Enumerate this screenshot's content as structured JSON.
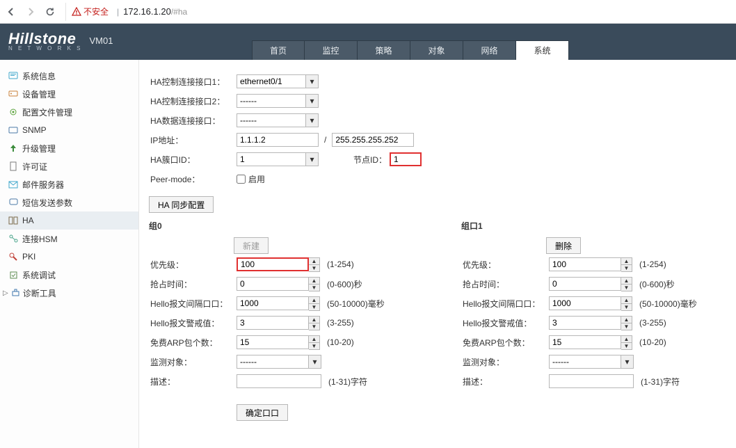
{
  "browser": {
    "warn_label": "不安全",
    "url_host": "172.16.1.20",
    "url_hash": "/#ha"
  },
  "header": {
    "brand": "Hillstone",
    "brand_sub": "N E T W O R K S",
    "hostname": "VM01",
    "tabs": [
      "首页",
      "监控",
      "策略",
      "对象",
      "网络",
      "系统"
    ],
    "active_tab": 5
  },
  "sidebar": {
    "items": [
      {
        "label": "系统信息",
        "icon": "info-icon"
      },
      {
        "label": "设备管理",
        "icon": "device-icon"
      },
      {
        "label": "配置文件管理",
        "icon": "config-icon"
      },
      {
        "label": "SNMP",
        "icon": "snmp-icon"
      },
      {
        "label": "升级管理",
        "icon": "upgrade-icon"
      },
      {
        "label": "许可证",
        "icon": "license-icon"
      },
      {
        "label": "邮件服务器",
        "icon": "mail-icon"
      },
      {
        "label": "短信发送参数",
        "icon": "sms-icon"
      },
      {
        "label": "HA",
        "icon": "ha-icon"
      },
      {
        "label": "连接HSM",
        "icon": "hsm-icon"
      },
      {
        "label": "PKI",
        "icon": "pki-icon"
      },
      {
        "label": "系统调试",
        "icon": "debug-icon"
      }
    ],
    "active": 8,
    "diag_label": "诊断工具"
  },
  "ha": {
    "labels": {
      "ctrl1": "HA控制连接接口1：",
      "ctrl2": "HA控制连接接口2：",
      "data": "HA数据连接接口：",
      "ip": "IP地址：",
      "cluster": "HA簇口ID：",
      "node": "节点ID：",
      "peer": "Peer-mode：",
      "enable": "启用",
      "sync_btn": "HA 同步配置"
    },
    "values": {
      "ctrl1": "ethernet0/1",
      "ctrl2": "------",
      "data": "------",
      "ip": "1.1.1.2",
      "mask": "255.255.255.252",
      "cluster": "1",
      "node": "1"
    }
  },
  "group_labels": {
    "g0": "组0",
    "g1": "组口1",
    "new_btn": "新建",
    "del_btn": "删除",
    "fields": {
      "priority": "优先级：",
      "preempt": "抢占时间：",
      "hello_int": "Hello报文间隔口口：",
      "hello_thr": "Hello报文警戒值：",
      "arp": "免费ARP包个数：",
      "monitor": "监测对象：",
      "desc": "描述："
    },
    "ranges": {
      "priority": "(1-254)",
      "preempt": "(0-600)秒",
      "hello_int": "(50-10000)毫秒",
      "hello_thr": "(3-255)",
      "arp": "(10-20)",
      "desc": "(1-31)字符"
    },
    "confirm": "确定口口"
  },
  "group0": {
    "priority": "100",
    "preempt": "0",
    "hello_int": "1000",
    "hello_thr": "3",
    "arp": "15",
    "monitor": "------",
    "desc": ""
  },
  "group1": {
    "priority": "100",
    "preempt": "0",
    "hello_int": "1000",
    "hello_thr": "3",
    "arp": "15",
    "monitor": "------",
    "desc": ""
  }
}
